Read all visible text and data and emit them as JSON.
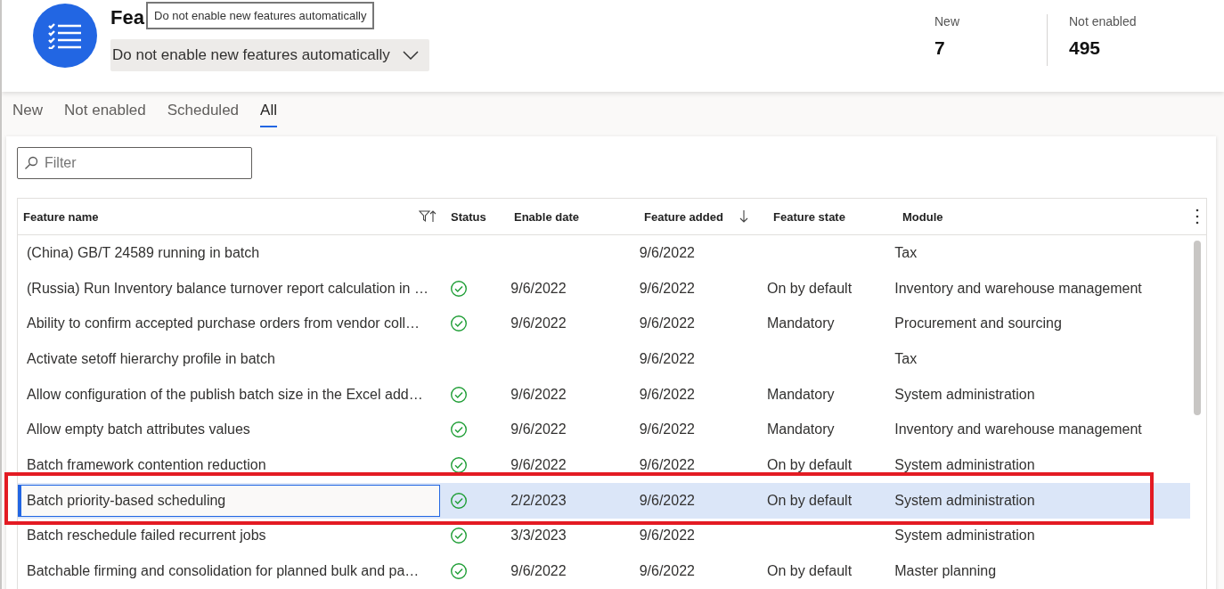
{
  "header": {
    "title": "Fea",
    "tooltip": "Do not enable new features automatically",
    "dropdown": {
      "value": "Do not enable new features automatically"
    },
    "stats": [
      {
        "label": "New",
        "value": "7"
      },
      {
        "label": "Not enabled",
        "value": "495"
      }
    ]
  },
  "tabs": [
    {
      "label": "New",
      "selected": false
    },
    {
      "label": "Not enabled",
      "selected": false
    },
    {
      "label": "Scheduled",
      "selected": false
    },
    {
      "label": "All",
      "selected": true
    }
  ],
  "filter": {
    "placeholder": "Filter"
  },
  "table": {
    "columns": [
      "Feature name",
      "Status",
      "Enable date",
      "Feature added",
      "Feature state",
      "Module"
    ],
    "rows": [
      {
        "name": "(China) GB/T 24589 running in batch",
        "enabled": false,
        "enable_date": "",
        "feature_added": "9/6/2022",
        "feature_state": "",
        "module": "Tax",
        "selected": false
      },
      {
        "name": "(Russia) Run Inventory balance turnover report calculation in …",
        "enabled": true,
        "enable_date": "9/6/2022",
        "feature_added": "9/6/2022",
        "feature_state": "On by default",
        "module": "Inventory and warehouse management",
        "selected": false
      },
      {
        "name": "Ability to confirm accepted purchase orders from vendor coll…",
        "enabled": true,
        "enable_date": "9/6/2022",
        "feature_added": "9/6/2022",
        "feature_state": "Mandatory",
        "module": "Procurement and sourcing",
        "selected": false
      },
      {
        "name": "Activate setoff hierarchy profile in batch",
        "enabled": false,
        "enable_date": "",
        "feature_added": "9/6/2022",
        "feature_state": "",
        "module": "Tax",
        "selected": false
      },
      {
        "name": "Allow configuration of the publish batch size in the Excel add…",
        "enabled": true,
        "enable_date": "9/6/2022",
        "feature_added": "9/6/2022",
        "feature_state": "Mandatory",
        "module": "System administration",
        "selected": false
      },
      {
        "name": "Allow empty batch attributes values",
        "enabled": true,
        "enable_date": "9/6/2022",
        "feature_added": "9/6/2022",
        "feature_state": "Mandatory",
        "module": "Inventory and warehouse management",
        "selected": false
      },
      {
        "name": "Batch framework contention reduction",
        "enabled": true,
        "enable_date": "9/6/2022",
        "feature_added": "9/6/2022",
        "feature_state": "On by default",
        "module": "System administration",
        "selected": false
      },
      {
        "name": "Batch priority-based scheduling",
        "enabled": true,
        "enable_date": "2/2/2023",
        "feature_added": "9/6/2022",
        "feature_state": "On by default",
        "module": "System administration",
        "selected": true
      },
      {
        "name": "Batch reschedule failed recurrent jobs",
        "enabled": true,
        "enable_date": "3/3/2023",
        "feature_added": "9/6/2022",
        "feature_state": "",
        "module": "System administration",
        "selected": false
      },
      {
        "name": "Batchable firming and consolidation for planned bulk and pa…",
        "enabled": true,
        "enable_date": "9/6/2022",
        "feature_added": "9/6/2022",
        "feature_state": "On by default",
        "module": "Master planning",
        "selected": false
      }
    ]
  }
}
